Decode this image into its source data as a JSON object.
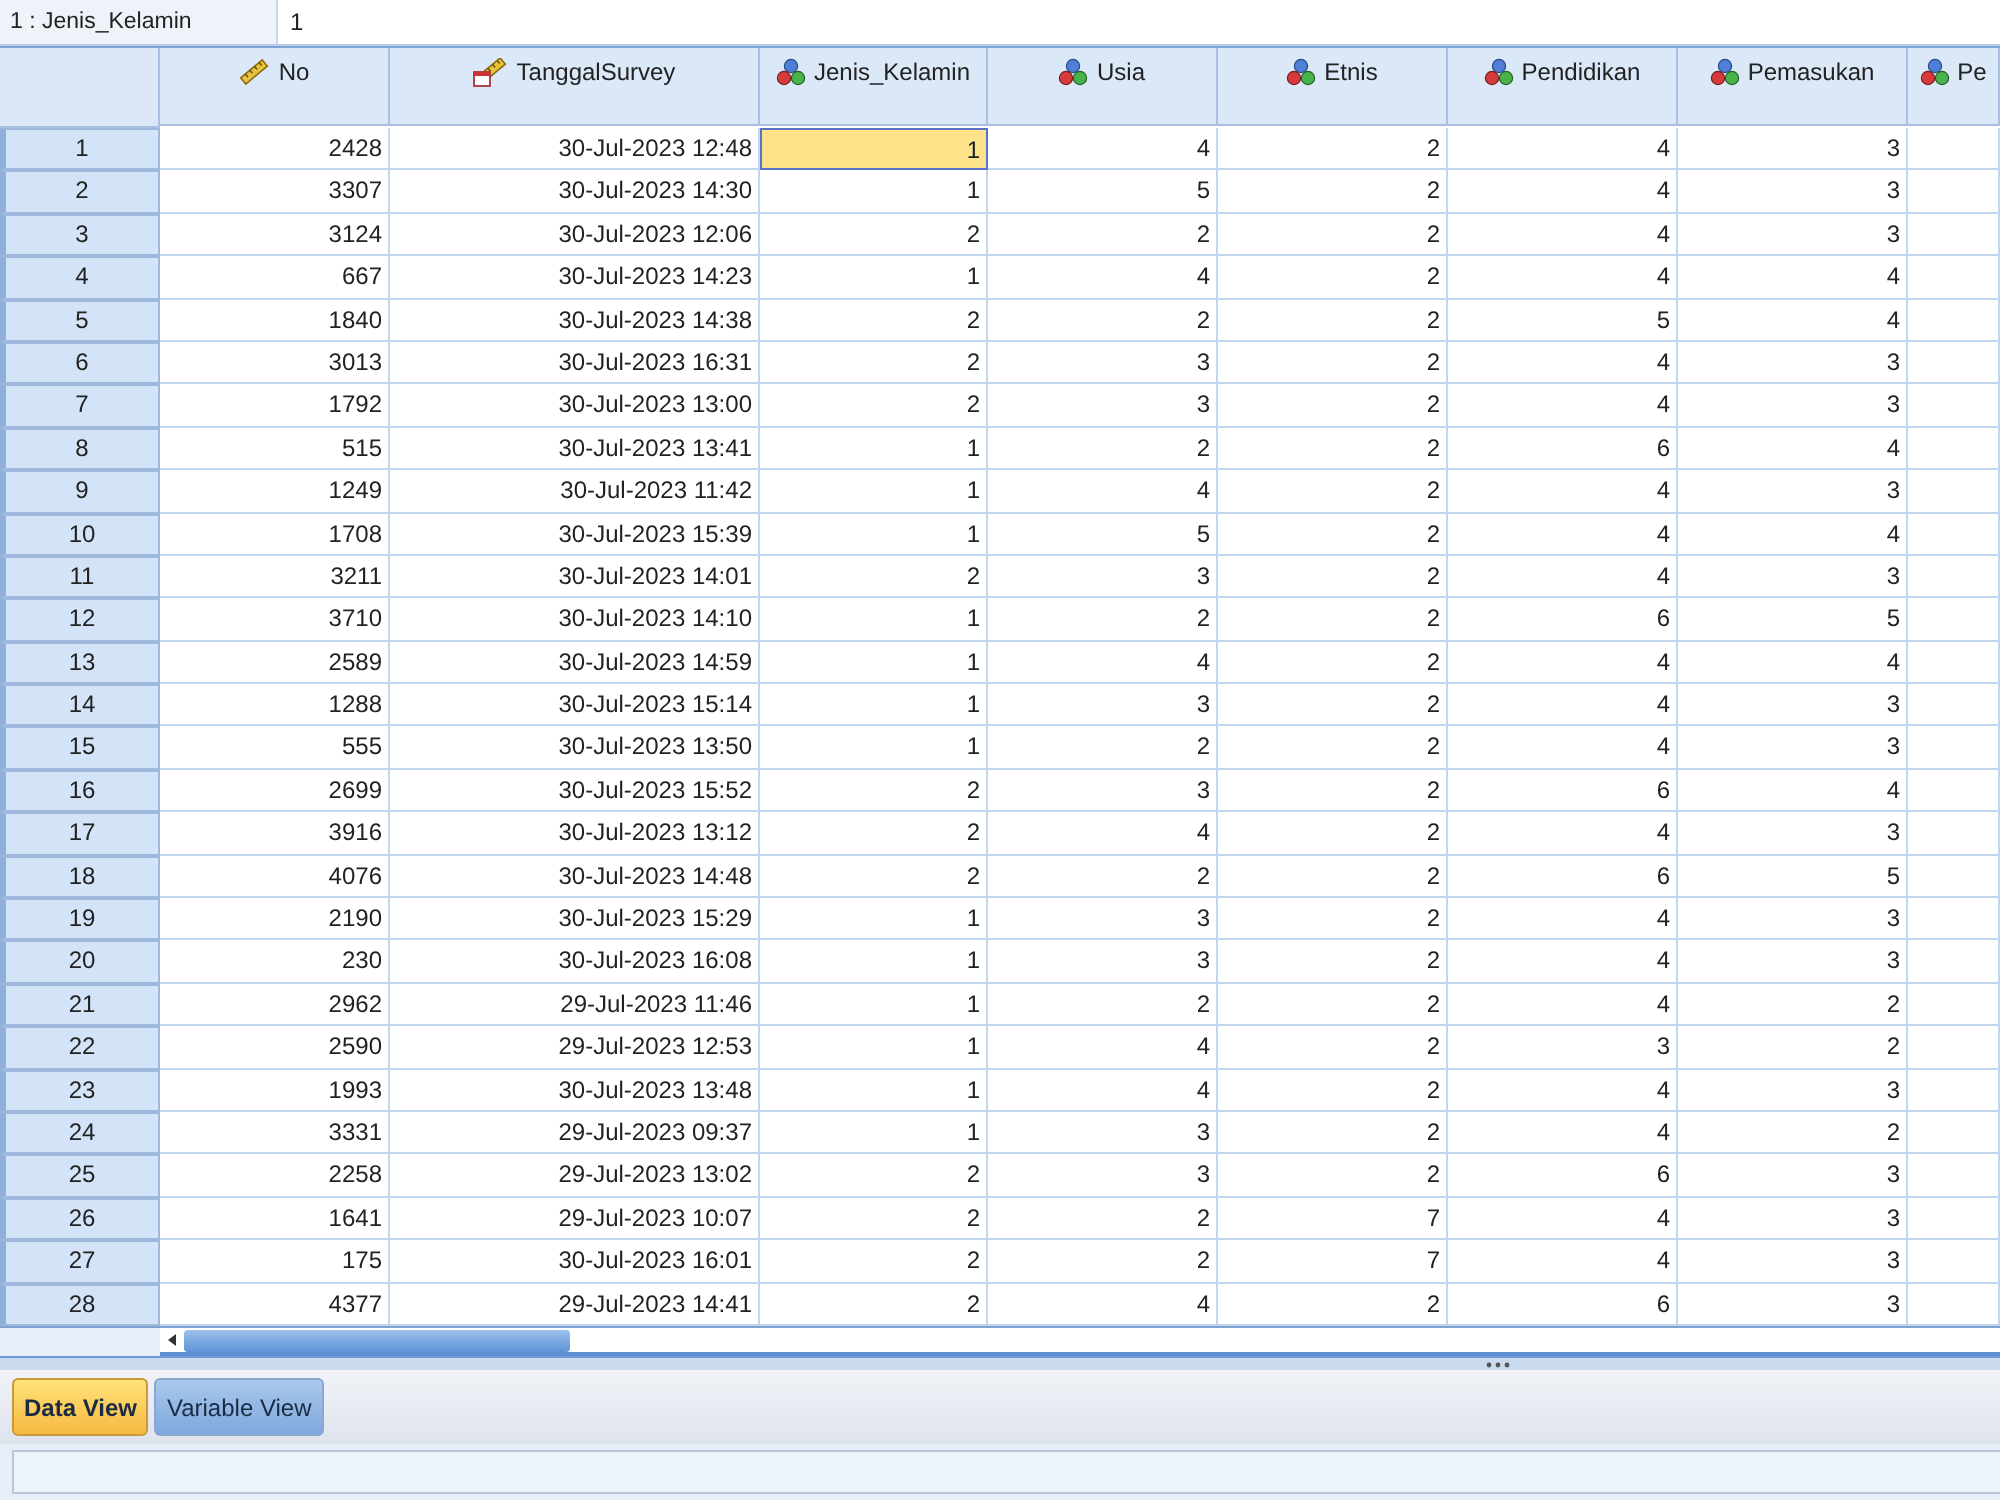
{
  "cell_editor": {
    "reference": "1 : Jenis_Kelamin",
    "value": "1"
  },
  "columns": [
    {
      "label": "No",
      "kind": "scale"
    },
    {
      "label": "TanggalSurvey",
      "kind": "date"
    },
    {
      "label": "Jenis_Kelamin",
      "kind": "nominal"
    },
    {
      "label": "Usia",
      "kind": "nominal"
    },
    {
      "label": "Etnis",
      "kind": "nominal"
    },
    {
      "label": "Pendidikan",
      "kind": "nominal"
    },
    {
      "label": "Pemasukan",
      "kind": "nominal"
    },
    {
      "label": "Pe",
      "kind": "nominal"
    }
  ],
  "rows": [
    {
      "label": "1",
      "cells": [
        {
          "value": "2428",
          "selected": false
        },
        {
          "value": "30-Jul-2023 12:48",
          "selected": false
        },
        {
          "value": "1",
          "selected": true
        },
        {
          "value": "4",
          "selected": false
        },
        {
          "value": "2",
          "selected": false
        },
        {
          "value": "4",
          "selected": false
        },
        {
          "value": "3",
          "selected": false
        }
      ]
    },
    {
      "label": "2",
      "cells": [
        {
          "value": "3307",
          "selected": false
        },
        {
          "value": "30-Jul-2023 14:30",
          "selected": false
        },
        {
          "value": "1",
          "selected": false
        },
        {
          "value": "5",
          "selected": false
        },
        {
          "value": "2",
          "selected": false
        },
        {
          "value": "4",
          "selected": false
        },
        {
          "value": "3",
          "selected": false
        }
      ]
    },
    {
      "label": "3",
      "cells": [
        {
          "value": "3124",
          "selected": false
        },
        {
          "value": "30-Jul-2023 12:06",
          "selected": false
        },
        {
          "value": "2",
          "selected": false
        },
        {
          "value": "2",
          "selected": false
        },
        {
          "value": "2",
          "selected": false
        },
        {
          "value": "4",
          "selected": false
        },
        {
          "value": "3",
          "selected": false
        }
      ]
    },
    {
      "label": "4",
      "cells": [
        {
          "value": "667",
          "selected": false
        },
        {
          "value": "30-Jul-2023 14:23",
          "selected": false
        },
        {
          "value": "1",
          "selected": false
        },
        {
          "value": "4",
          "selected": false
        },
        {
          "value": "2",
          "selected": false
        },
        {
          "value": "4",
          "selected": false
        },
        {
          "value": "4",
          "selected": false
        }
      ]
    },
    {
      "label": "5",
      "cells": [
        {
          "value": "1840",
          "selected": false
        },
        {
          "value": "30-Jul-2023 14:38",
          "selected": false
        },
        {
          "value": "2",
          "selected": false
        },
        {
          "value": "2",
          "selected": false
        },
        {
          "value": "2",
          "selected": false
        },
        {
          "value": "5",
          "selected": false
        },
        {
          "value": "4",
          "selected": false
        }
      ]
    },
    {
      "label": "6",
      "cells": [
        {
          "value": "3013",
          "selected": false
        },
        {
          "value": "30-Jul-2023 16:31",
          "selected": false
        },
        {
          "value": "2",
          "selected": false
        },
        {
          "value": "3",
          "selected": false
        },
        {
          "value": "2",
          "selected": false
        },
        {
          "value": "4",
          "selected": false
        },
        {
          "value": "3",
          "selected": false
        }
      ]
    },
    {
      "label": "7",
      "cells": [
        {
          "value": "1792",
          "selected": false
        },
        {
          "value": "30-Jul-2023 13:00",
          "selected": false
        },
        {
          "value": "2",
          "selected": false
        },
        {
          "value": "3",
          "selected": false
        },
        {
          "value": "2",
          "selected": false
        },
        {
          "value": "4",
          "selected": false
        },
        {
          "value": "3",
          "selected": false
        }
      ]
    },
    {
      "label": "8",
      "cells": [
        {
          "value": "515",
          "selected": false
        },
        {
          "value": "30-Jul-2023 13:41",
          "selected": false
        },
        {
          "value": "1",
          "selected": false
        },
        {
          "value": "2",
          "selected": false
        },
        {
          "value": "2",
          "selected": false
        },
        {
          "value": "6",
          "selected": false
        },
        {
          "value": "4",
          "selected": false
        }
      ]
    },
    {
      "label": "9",
      "cells": [
        {
          "value": "1249",
          "selected": false
        },
        {
          "value": "30-Jul-2023 11:42",
          "selected": false
        },
        {
          "value": "1",
          "selected": false
        },
        {
          "value": "4",
          "selected": false
        },
        {
          "value": "2",
          "selected": false
        },
        {
          "value": "4",
          "selected": false
        },
        {
          "value": "3",
          "selected": false
        }
      ]
    },
    {
      "label": "10",
      "cells": [
        {
          "value": "1708",
          "selected": false
        },
        {
          "value": "30-Jul-2023 15:39",
          "selected": false
        },
        {
          "value": "1",
          "selected": false
        },
        {
          "value": "5",
          "selected": false
        },
        {
          "value": "2",
          "selected": false
        },
        {
          "value": "4",
          "selected": false
        },
        {
          "value": "4",
          "selected": false
        }
      ]
    },
    {
      "label": "11",
      "cells": [
        {
          "value": "3211",
          "selected": false
        },
        {
          "value": "30-Jul-2023 14:01",
          "selected": false
        },
        {
          "value": "2",
          "selected": false
        },
        {
          "value": "3",
          "selected": false
        },
        {
          "value": "2",
          "selected": false
        },
        {
          "value": "4",
          "selected": false
        },
        {
          "value": "3",
          "selected": false
        }
      ]
    },
    {
      "label": "12",
      "cells": [
        {
          "value": "3710",
          "selected": false
        },
        {
          "value": "30-Jul-2023 14:10",
          "selected": false
        },
        {
          "value": "1",
          "selected": false
        },
        {
          "value": "2",
          "selected": false
        },
        {
          "value": "2",
          "selected": false
        },
        {
          "value": "6",
          "selected": false
        },
        {
          "value": "5",
          "selected": false
        }
      ]
    },
    {
      "label": "13",
      "cells": [
        {
          "value": "2589",
          "selected": false
        },
        {
          "value": "30-Jul-2023 14:59",
          "selected": false
        },
        {
          "value": "1",
          "selected": false
        },
        {
          "value": "4",
          "selected": false
        },
        {
          "value": "2",
          "selected": false
        },
        {
          "value": "4",
          "selected": false
        },
        {
          "value": "4",
          "selected": false
        }
      ]
    },
    {
      "label": "14",
      "cells": [
        {
          "value": "1288",
          "selected": false
        },
        {
          "value": "30-Jul-2023 15:14",
          "selected": false
        },
        {
          "value": "1",
          "selected": false
        },
        {
          "value": "3",
          "selected": false
        },
        {
          "value": "2",
          "selected": false
        },
        {
          "value": "4",
          "selected": false
        },
        {
          "value": "3",
          "selected": false
        }
      ]
    },
    {
      "label": "15",
      "cells": [
        {
          "value": "555",
          "selected": false
        },
        {
          "value": "30-Jul-2023 13:50",
          "selected": false
        },
        {
          "value": "1",
          "selected": false
        },
        {
          "value": "2",
          "selected": false
        },
        {
          "value": "2",
          "selected": false
        },
        {
          "value": "4",
          "selected": false
        },
        {
          "value": "3",
          "selected": false
        }
      ]
    },
    {
      "label": "16",
      "cells": [
        {
          "value": "2699",
          "selected": false
        },
        {
          "value": "30-Jul-2023 15:52",
          "selected": false
        },
        {
          "value": "2",
          "selected": false
        },
        {
          "value": "3",
          "selected": false
        },
        {
          "value": "2",
          "selected": false
        },
        {
          "value": "6",
          "selected": false
        },
        {
          "value": "4",
          "selected": false
        }
      ]
    },
    {
      "label": "17",
      "cells": [
        {
          "value": "3916",
          "selected": false
        },
        {
          "value": "30-Jul-2023 13:12",
          "selected": false
        },
        {
          "value": "2",
          "selected": false
        },
        {
          "value": "4",
          "selected": false
        },
        {
          "value": "2",
          "selected": false
        },
        {
          "value": "4",
          "selected": false
        },
        {
          "value": "3",
          "selected": false
        }
      ]
    },
    {
      "label": "18",
      "cells": [
        {
          "value": "4076",
          "selected": false
        },
        {
          "value": "30-Jul-2023 14:48",
          "selected": false
        },
        {
          "value": "2",
          "selected": false
        },
        {
          "value": "2",
          "selected": false
        },
        {
          "value": "2",
          "selected": false
        },
        {
          "value": "6",
          "selected": false
        },
        {
          "value": "5",
          "selected": false
        }
      ]
    },
    {
      "label": "19",
      "cells": [
        {
          "value": "2190",
          "selected": false
        },
        {
          "value": "30-Jul-2023 15:29",
          "selected": false
        },
        {
          "value": "1",
          "selected": false
        },
        {
          "value": "3",
          "selected": false
        },
        {
          "value": "2",
          "selected": false
        },
        {
          "value": "4",
          "selected": false
        },
        {
          "value": "3",
          "selected": false
        }
      ]
    },
    {
      "label": "20",
      "cells": [
        {
          "value": "230",
          "selected": false
        },
        {
          "value": "30-Jul-2023 16:08",
          "selected": false
        },
        {
          "value": "1",
          "selected": false
        },
        {
          "value": "3",
          "selected": false
        },
        {
          "value": "2",
          "selected": false
        },
        {
          "value": "4",
          "selected": false
        },
        {
          "value": "3",
          "selected": false
        }
      ]
    },
    {
      "label": "21",
      "cells": [
        {
          "value": "2962",
          "selected": false
        },
        {
          "value": "29-Jul-2023 11:46",
          "selected": false
        },
        {
          "value": "1",
          "selected": false
        },
        {
          "value": "2",
          "selected": false
        },
        {
          "value": "2",
          "selected": false
        },
        {
          "value": "4",
          "selected": false
        },
        {
          "value": "2",
          "selected": false
        }
      ]
    },
    {
      "label": "22",
      "cells": [
        {
          "value": "2590",
          "selected": false
        },
        {
          "value": "29-Jul-2023 12:53",
          "selected": false
        },
        {
          "value": "1",
          "selected": false
        },
        {
          "value": "4",
          "selected": false
        },
        {
          "value": "2",
          "selected": false
        },
        {
          "value": "3",
          "selected": false
        },
        {
          "value": "2",
          "selected": false
        }
      ]
    },
    {
      "label": "23",
      "cells": [
        {
          "value": "1993",
          "selected": false
        },
        {
          "value": "30-Jul-2023 13:48",
          "selected": false
        },
        {
          "value": "1",
          "selected": false
        },
        {
          "value": "4",
          "selected": false
        },
        {
          "value": "2",
          "selected": false
        },
        {
          "value": "4",
          "selected": false
        },
        {
          "value": "3",
          "selected": false
        }
      ]
    },
    {
      "label": "24",
      "cells": [
        {
          "value": "3331",
          "selected": false
        },
        {
          "value": "29-Jul-2023 09:37",
          "selected": false
        },
        {
          "value": "1",
          "selected": false
        },
        {
          "value": "3",
          "selected": false
        },
        {
          "value": "2",
          "selected": false
        },
        {
          "value": "4",
          "selected": false
        },
        {
          "value": "2",
          "selected": false
        }
      ]
    },
    {
      "label": "25",
      "cells": [
        {
          "value": "2258",
          "selected": false
        },
        {
          "value": "29-Jul-2023 13:02",
          "selected": false
        },
        {
          "value": "2",
          "selected": false
        },
        {
          "value": "3",
          "selected": false
        },
        {
          "value": "2",
          "selected": false
        },
        {
          "value": "6",
          "selected": false
        },
        {
          "value": "3",
          "selected": false
        }
      ]
    },
    {
      "label": "26",
      "cells": [
        {
          "value": "1641",
          "selected": false
        },
        {
          "value": "29-Jul-2023 10:07",
          "selected": false
        },
        {
          "value": "2",
          "selected": false
        },
        {
          "value": "2",
          "selected": false
        },
        {
          "value": "7",
          "selected": false
        },
        {
          "value": "4",
          "selected": false
        },
        {
          "value": "3",
          "selected": false
        }
      ]
    },
    {
      "label": "27",
      "cells": [
        {
          "value": "175",
          "selected": false
        },
        {
          "value": "30-Jul-2023 16:01",
          "selected": false
        },
        {
          "value": "2",
          "selected": false
        },
        {
          "value": "2",
          "selected": false
        },
        {
          "value": "7",
          "selected": false
        },
        {
          "value": "4",
          "selected": false
        },
        {
          "value": "3",
          "selected": false
        }
      ]
    },
    {
      "label": "28",
      "cells": [
        {
          "value": "4377",
          "selected": false
        },
        {
          "value": "29-Jul-2023 14:41",
          "selected": false
        },
        {
          "value": "2",
          "selected": false
        },
        {
          "value": "4",
          "selected": false
        },
        {
          "value": "2",
          "selected": false
        },
        {
          "value": "6",
          "selected": false
        },
        {
          "value": "3",
          "selected": false
        }
      ]
    }
  ],
  "tabs": [
    {
      "label": "Data View",
      "selected": true
    },
    {
      "label": "Variable View",
      "selected": false
    }
  ]
}
